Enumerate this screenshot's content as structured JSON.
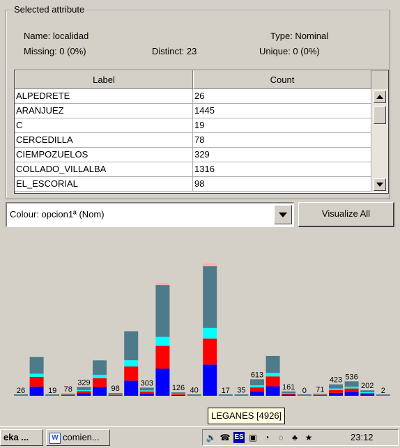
{
  "attribute": {
    "group_title": "Selected attribute",
    "name": "Name: localidad",
    "type": "Type: Nominal",
    "missing": "Missing: 0 (0%)",
    "distinct": "Distinct: 23",
    "unique": "Unique: 0 (0%)"
  },
  "table": {
    "columns": [
      "Label",
      "Count"
    ],
    "rows": [
      {
        "label": "ALPEDRETE",
        "count": "26"
      },
      {
        "label": "ARANJUEZ",
        "count": "1445"
      },
      {
        "label": "C",
        "count": "19"
      },
      {
        "label": "CERCEDILLA",
        "count": "78"
      },
      {
        "label": "CIEMPOZUELOS",
        "count": "329"
      },
      {
        "label": "COLLADO_VILLALBA",
        "count": "1316"
      },
      {
        "label": "EL_ESCORIAL",
        "count": "98"
      }
    ]
  },
  "colour": {
    "selected": "Colour: opcion1ª (Nom)"
  },
  "visualize_all": "Visualize All",
  "tooltip": "LEGANES [4926]",
  "taskbar": {
    "task1": "eka ...",
    "task2": "comien...",
    "clock": "23:12",
    "lang": "ES"
  },
  "colors": {
    "blue": "#0000ff",
    "red": "#ff0000",
    "cyan": "#00ffff",
    "slate": "#4d7b8a",
    "pink": "#ffb0b0"
  },
  "chart_data": {
    "type": "bar",
    "stacked": true,
    "categories_visible_labels": [
      "26",
      "19",
      "78",
      "329",
      "98",
      "303",
      "126",
      "40",
      "17",
      "35",
      "613",
      "161",
      "0",
      "71",
      "423",
      "536",
      "202",
      "2"
    ],
    "bars": [
      {
        "label": "26",
        "total": 26,
        "segments": [
          0,
          0,
          0,
          0,
          0
        ]
      },
      {
        "label": "1445",
        "total": 1445,
        "segments": [
          300,
          320,
          100,
          550,
          0
        ],
        "show_label": false
      },
      {
        "label": "19",
        "total": 19,
        "segments": [
          0,
          0,
          0,
          0,
          0
        ]
      },
      {
        "label": "78",
        "total": 78,
        "segments": [
          20,
          20,
          10,
          28,
          0
        ]
      },
      {
        "label": "329",
        "total": 329,
        "segments": [
          90,
          80,
          40,
          119,
          0
        ]
      },
      {
        "label": "1316",
        "total": 1316,
        "segments": [
          330,
          320,
          130,
          536,
          0
        ],
        "show_label": false
      },
      {
        "label": "98",
        "total": 98,
        "segments": [
          20,
          20,
          10,
          48,
          0
        ]
      },
      {
        "label": "2400",
        "total": 2400,
        "segments": [
          560,
          530,
          230,
          1080,
          0
        ],
        "show_label": false
      },
      {
        "label": "303",
        "total": 303,
        "segments": [
          80,
          80,
          40,
          103,
          0
        ]
      },
      {
        "label": "4200",
        "total": 4200,
        "segments": [
          1010,
          850,
          330,
          1930,
          80
        ],
        "show_label": false
      },
      {
        "label": "126",
        "total": 126,
        "segments": [
          30,
          30,
          10,
          56,
          0
        ]
      },
      {
        "label": "40",
        "total": 40,
        "segments": [
          0,
          0,
          0,
          0,
          0
        ]
      },
      {
        "label": "4926",
        "total": 4926,
        "segments": [
          1160,
          970,
          390,
          2300,
          106
        ],
        "show_label": false
      },
      {
        "label": "17",
        "total": 17,
        "segments": [
          0,
          0,
          0,
          0,
          0
        ]
      },
      {
        "label": "35",
        "total": 35,
        "segments": [
          0,
          0,
          0,
          0,
          0
        ]
      },
      {
        "label": "613",
        "total": 613,
        "segments": [
          160,
          150,
          80,
          223,
          0
        ]
      },
      {
        "label": "1480",
        "total": 1480,
        "segments": [
          350,
          370,
          130,
          630,
          0
        ],
        "show_label": false
      },
      {
        "label": "161",
        "total": 161,
        "segments": [
          40,
          40,
          20,
          61,
          0
        ]
      },
      {
        "label": "0",
        "total": 0,
        "segments": [
          0,
          0,
          0,
          0,
          0
        ]
      },
      {
        "label": "71",
        "total": 71,
        "segments": [
          20,
          20,
          10,
          21,
          0
        ]
      },
      {
        "label": "423",
        "total": 423,
        "segments": [
          110,
          100,
          60,
          153,
          0
        ]
      },
      {
        "label": "536",
        "total": 536,
        "segments": [
          140,
          130,
          70,
          196,
          0
        ]
      },
      {
        "label": "202",
        "total": 202,
        "segments": [
          50,
          50,
          30,
          72,
          0
        ]
      },
      {
        "label": "2",
        "total": 2,
        "segments": [
          0,
          0,
          0,
          0,
          0
        ]
      }
    ],
    "ymax": 4926
  }
}
